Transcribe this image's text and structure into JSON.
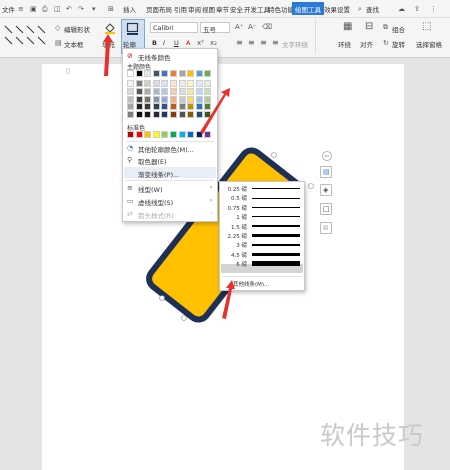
{
  "menubar": {
    "file": "文件",
    "tabs": [
      "插入",
      "页面布局",
      "引用",
      "审阅",
      "视图",
      "章节",
      "安全",
      "开发工具",
      "特色功能"
    ],
    "active_tab": "绘图工具",
    "effect_tab": "效果设置",
    "search": "查找"
  },
  "ribbon": {
    "edit_shape": "编辑形状",
    "text_box": "文本框",
    "fill": "填充",
    "outline": "轮廓",
    "font_name": "Calibri",
    "font_size": "五号",
    "text_wrap": "文字环绕",
    "wrap": "环绕",
    "align": "对齐",
    "group": "组合",
    "rotate": "旋转",
    "select_pane": "选择窗格",
    "bold": "B",
    "italic": "I",
    "underline": "U",
    "font_color_a": "A"
  },
  "color_menu": {
    "no_line": "无线条颜色",
    "theme_colors": "主题颜色",
    "standard_colors": "标准色",
    "more_colors": "其他轮廓颜色(M)...",
    "eyedropper": "取色器(E)",
    "gradient_line": "渐变线条(P)...",
    "line_type": "线型(W)",
    "dash_type": "虚线线型(S)",
    "arrow_style": "箭头样式(R)",
    "theme_top_row": [
      "#ffffff",
      "#000000",
      "#e7e6e6",
      "#44546a",
      "#4472c4",
      "#ed7d31",
      "#a5a5a5",
      "#ffc000",
      "#5b9bd5",
      "#70ad47"
    ],
    "theme_shades": [
      [
        "#f2f2f2",
        "#7f7f7f",
        "#d0cece",
        "#d6dce4",
        "#d9e2f3",
        "#fbe5d5",
        "#ededed",
        "#fff2cc",
        "#deebf6",
        "#e2efd9"
      ],
      [
        "#d8d8d8",
        "#595959",
        "#aeabab",
        "#adb9ca",
        "#b4c6e7",
        "#f7cbac",
        "#dbdbdb",
        "#fee599",
        "#bdd7ee",
        "#c5e0b3"
      ],
      [
        "#bfbfbf",
        "#3f3f3f",
        "#757070",
        "#8496b0",
        "#8eaadb",
        "#f4b183",
        "#c9c9c9",
        "#ffd965",
        "#9cc3e5",
        "#a8d08d"
      ],
      [
        "#a5a5a5",
        "#262626",
        "#3a3838",
        "#323f4f",
        "#2f5496",
        "#c55a11",
        "#7b7b7b",
        "#bf9000",
        "#2e75b5",
        "#538135"
      ],
      [
        "#7f7f7f",
        "#0c0c0c",
        "#171616",
        "#222a35",
        "#1f3864",
        "#833c0b",
        "#525252",
        "#7f6000",
        "#1e4e79",
        "#375623"
      ]
    ],
    "standard_row": [
      "#c00000",
      "#ff0000",
      "#ffc000",
      "#ffff00",
      "#92d050",
      "#00b050",
      "#00b0f0",
      "#0070c0",
      "#002060",
      "#7030a0"
    ]
  },
  "line_menu": {
    "weights": [
      "0.25 磅",
      "0.5 磅",
      "0.75 磅",
      "1 磅",
      "1.5 磅",
      "2.25 磅",
      "3 磅",
      "4.5 磅",
      "6 磅"
    ],
    "selected": "6 磅",
    "more_lines": "其他线条(M)..."
  },
  "watermark": "软件技巧",
  "colors": {
    "accent": "#2b7bd6",
    "shape_fill": "#ffc000",
    "shape_outline": "#1f3056",
    "arrow_red": "#e8312f"
  }
}
